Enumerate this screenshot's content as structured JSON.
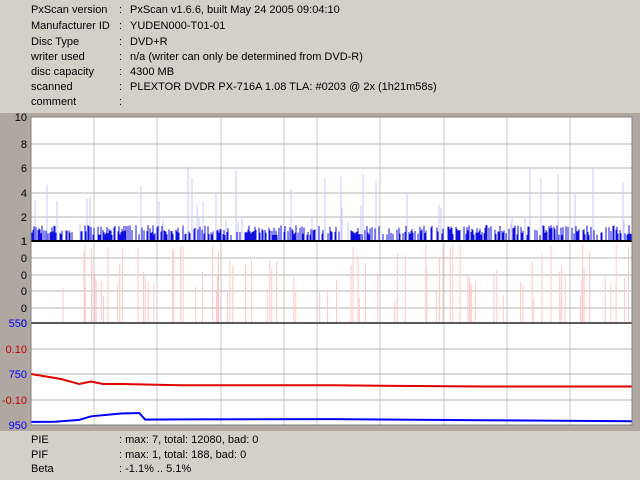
{
  "header": {
    "rows": [
      {
        "key": "PxScan version",
        "value": "PxScan v1.6.6, built May 24 2005 09:04:10"
      },
      {
        "key": "Manufacturer ID",
        "value": "YUDEN000-T01-01"
      },
      {
        "key": "Disc Type",
        "value": "DVD+R"
      },
      {
        "key": "writer used",
        "value": "n/a (writer can only be determined from DVD-R)"
      },
      {
        "key": "disc capacity",
        "value": "4300 MB"
      },
      {
        "key": "scanned",
        "value": "PLEXTOR DVDR PX-716A 1.08 TLA: #0203 @ 2x (1h21m58s)"
      },
      {
        "key": "comment",
        "value": ""
      }
    ]
  },
  "chart_data": [
    {
      "type": "bar",
      "name": "PIE",
      "y_ticks": [
        "10",
        "8",
        "6",
        "4",
        "2",
        "1"
      ],
      "ylim": [
        0,
        10
      ],
      "grid": true,
      "color": "#0000ff",
      "max": 7
    },
    {
      "type": "bar",
      "name": "PIF",
      "y_ticks": [
        "1",
        "0",
        "0",
        "0",
        "0",
        "0"
      ],
      "ylim": [
        0,
        1
      ],
      "grid": true,
      "color": "#ff0000",
      "max": 1
    },
    {
      "type": "line",
      "name": "Beta / Jitter",
      "left_ticks": [
        {
          "label": "550",
          "color": "#0000ff"
        },
        {
          "label": "0.10",
          "color": "#c00000"
        },
        {
          "label": "750",
          "color": "#0000ff"
        },
        {
          "label": "-0.10",
          "color": "#c00000"
        },
        {
          "label": "950",
          "color": "#0000ff"
        }
      ],
      "grid": true,
      "series": [
        {
          "name": "Beta",
          "color": "#e00000",
          "x": [
            0,
            5,
            8,
            10,
            12,
            15,
            25,
            50,
            75,
            100
          ],
          "values": [
            0.0,
            -0.02,
            -0.04,
            -0.03,
            -0.04,
            -0.04,
            -0.045,
            -0.045,
            -0.05,
            -0.05
          ]
        },
        {
          "name": "Jitter",
          "color": "#0000ff",
          "x": [
            0,
            4,
            8,
            10,
            15,
            18,
            19,
            25,
            50,
            75,
            100
          ],
          "values": [
            938,
            937,
            930,
            916,
            905,
            903,
            929,
            928,
            927,
            931,
            935
          ]
        }
      ]
    }
  ],
  "footer": {
    "rows": [
      {
        "key": "PIE",
        "value": ": max: 7, total: 12080, bad: 0"
      },
      {
        "key": "PIF",
        "value": ": max: 1, total: 188, bad: 0"
      },
      {
        "key": "Beta",
        "value": ": -1.1% .. 5.1%"
      }
    ]
  }
}
